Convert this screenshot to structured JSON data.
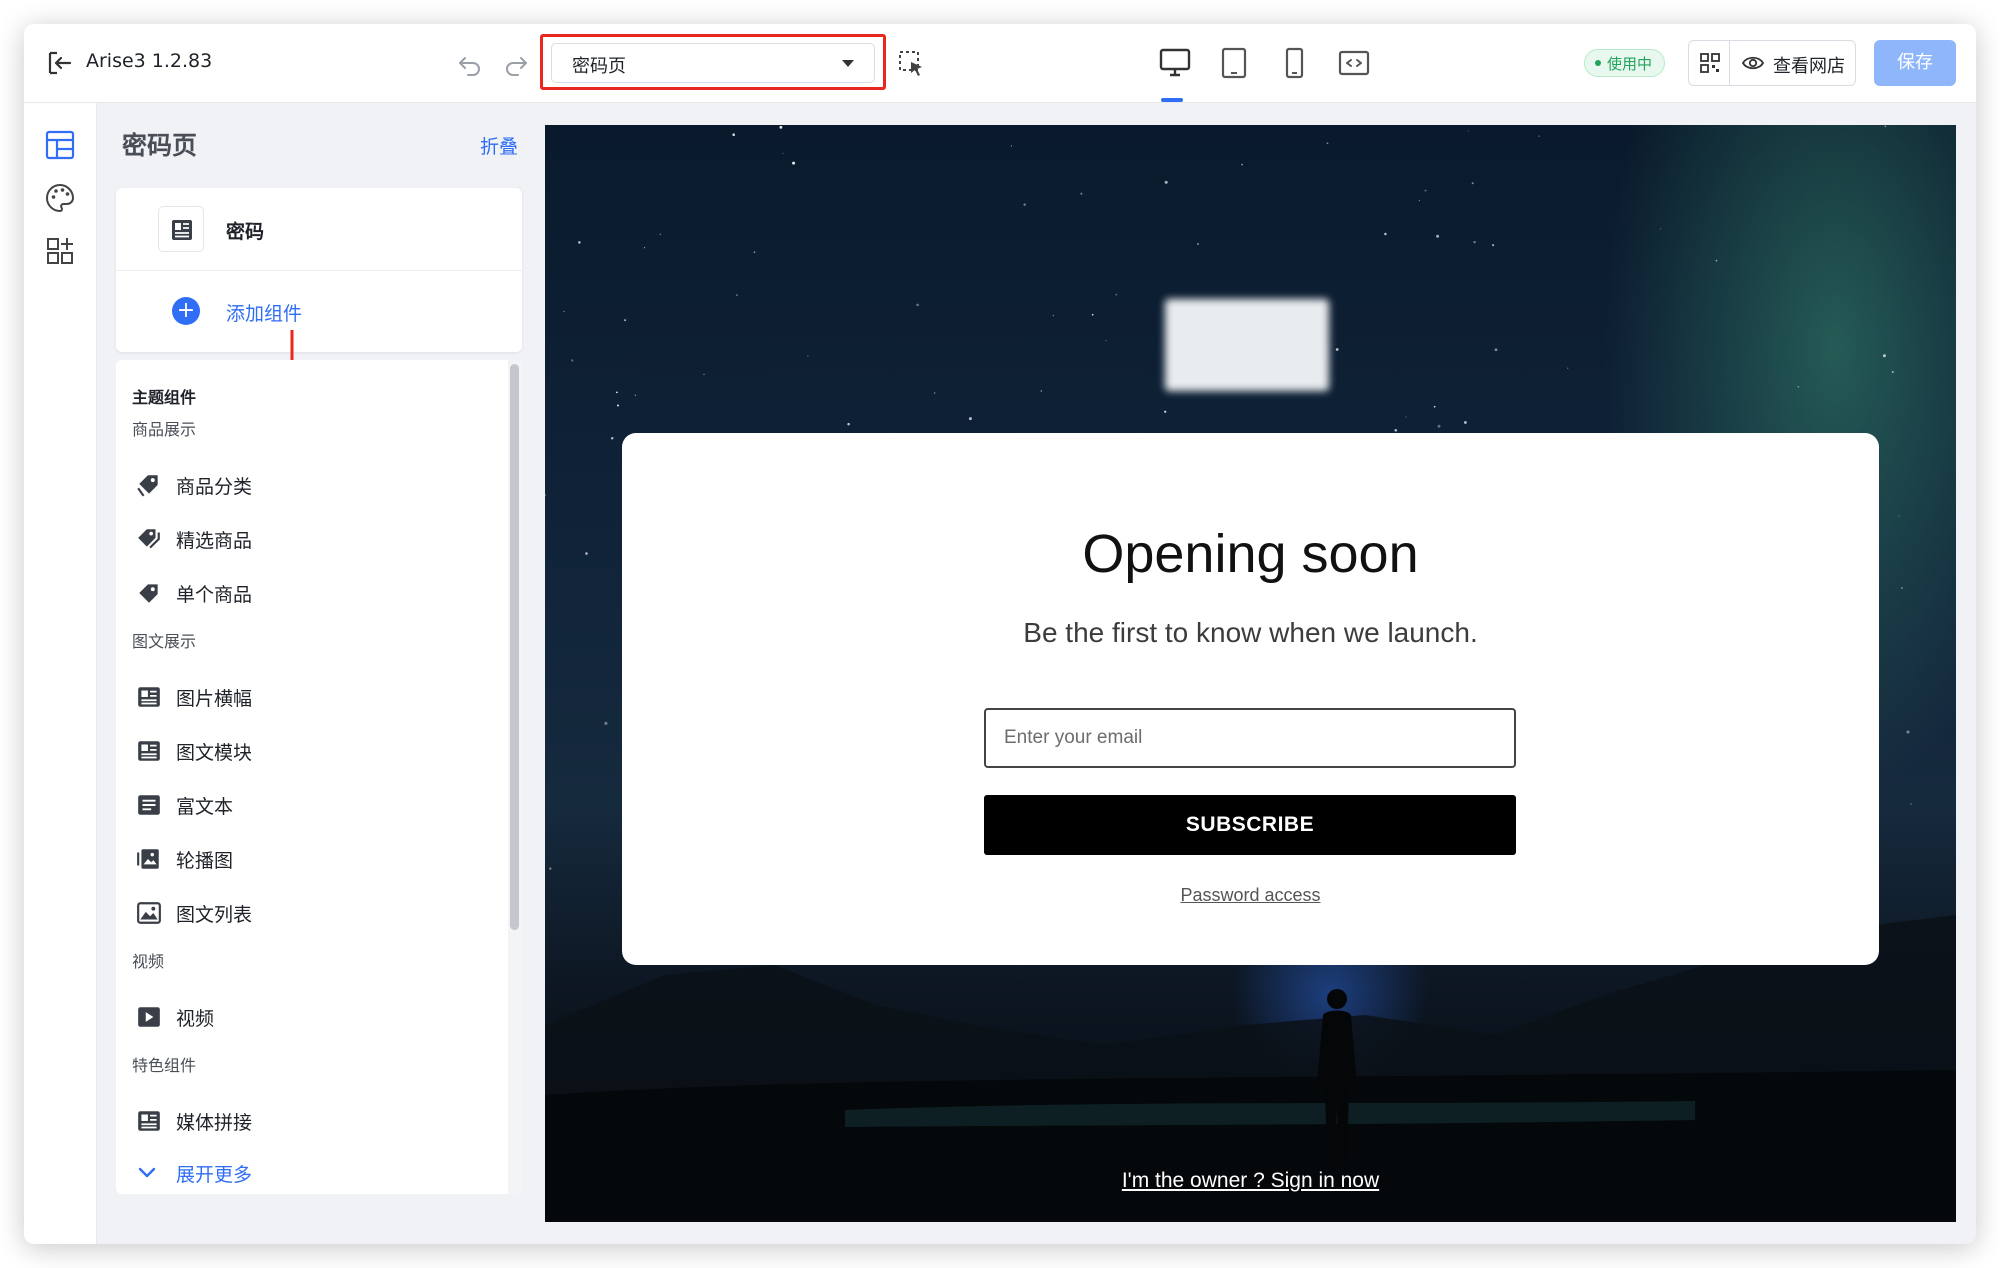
{
  "topbar": {
    "app_title": "Arise3 1.2.83",
    "page_select": "密码页",
    "status_badge": "使用中",
    "view_store": "查看网店",
    "save": "保存"
  },
  "icons": {
    "exit": "exit-icon",
    "undo": "undo-icon",
    "redo": "redo-icon",
    "select_tool": "select-tool-icon",
    "devices": [
      "desktop-icon",
      "tablet-icon",
      "mobile-icon",
      "fullscreen-icon"
    ],
    "qr": "qr-code-icon",
    "eye": "eye-icon"
  },
  "colors": {
    "accent": "#2f6ef5",
    "highlight_box": "#e8281e",
    "status_green": "#21a35a",
    "save_disabled": "#8fb6fb"
  },
  "panel": {
    "title": "密码页",
    "collapse": "折叠",
    "section_label": "密码",
    "add_component": "添加组件"
  },
  "library": {
    "theme_title": "主题组件",
    "categories": [
      {
        "title": "商品展示",
        "items": [
          {
            "label": "商品分类",
            "icon": "tag-cluster-icon"
          },
          {
            "label": "精选商品",
            "icon": "tags-icon"
          },
          {
            "label": "单个商品",
            "icon": "tag-icon"
          }
        ]
      },
      {
        "title": "图文展示",
        "items": [
          {
            "label": "图片横幅",
            "icon": "image-banner-icon"
          },
          {
            "label": "图文模块",
            "icon": "image-text-icon"
          },
          {
            "label": "富文本",
            "icon": "rich-text-icon"
          },
          {
            "label": "轮播图",
            "icon": "carousel-icon"
          },
          {
            "label": "图文列表",
            "icon": "image-list-icon"
          }
        ]
      },
      {
        "title": "视频",
        "items": [
          {
            "label": "视频",
            "icon": "video-icon"
          }
        ]
      },
      {
        "title": "特色组件",
        "items": [
          {
            "label": "媒体拼接",
            "icon": "media-collage-icon"
          }
        ]
      }
    ],
    "expand_more": "展开更多"
  },
  "preview": {
    "title": "Opening soon",
    "subtitle": "Be the first to know when we launch.",
    "email_placeholder": "Enter your email",
    "subscribe": "SUBSCRIBE",
    "password_access": "Password access",
    "owner_link": "I'm the owner ? Sign in now"
  }
}
